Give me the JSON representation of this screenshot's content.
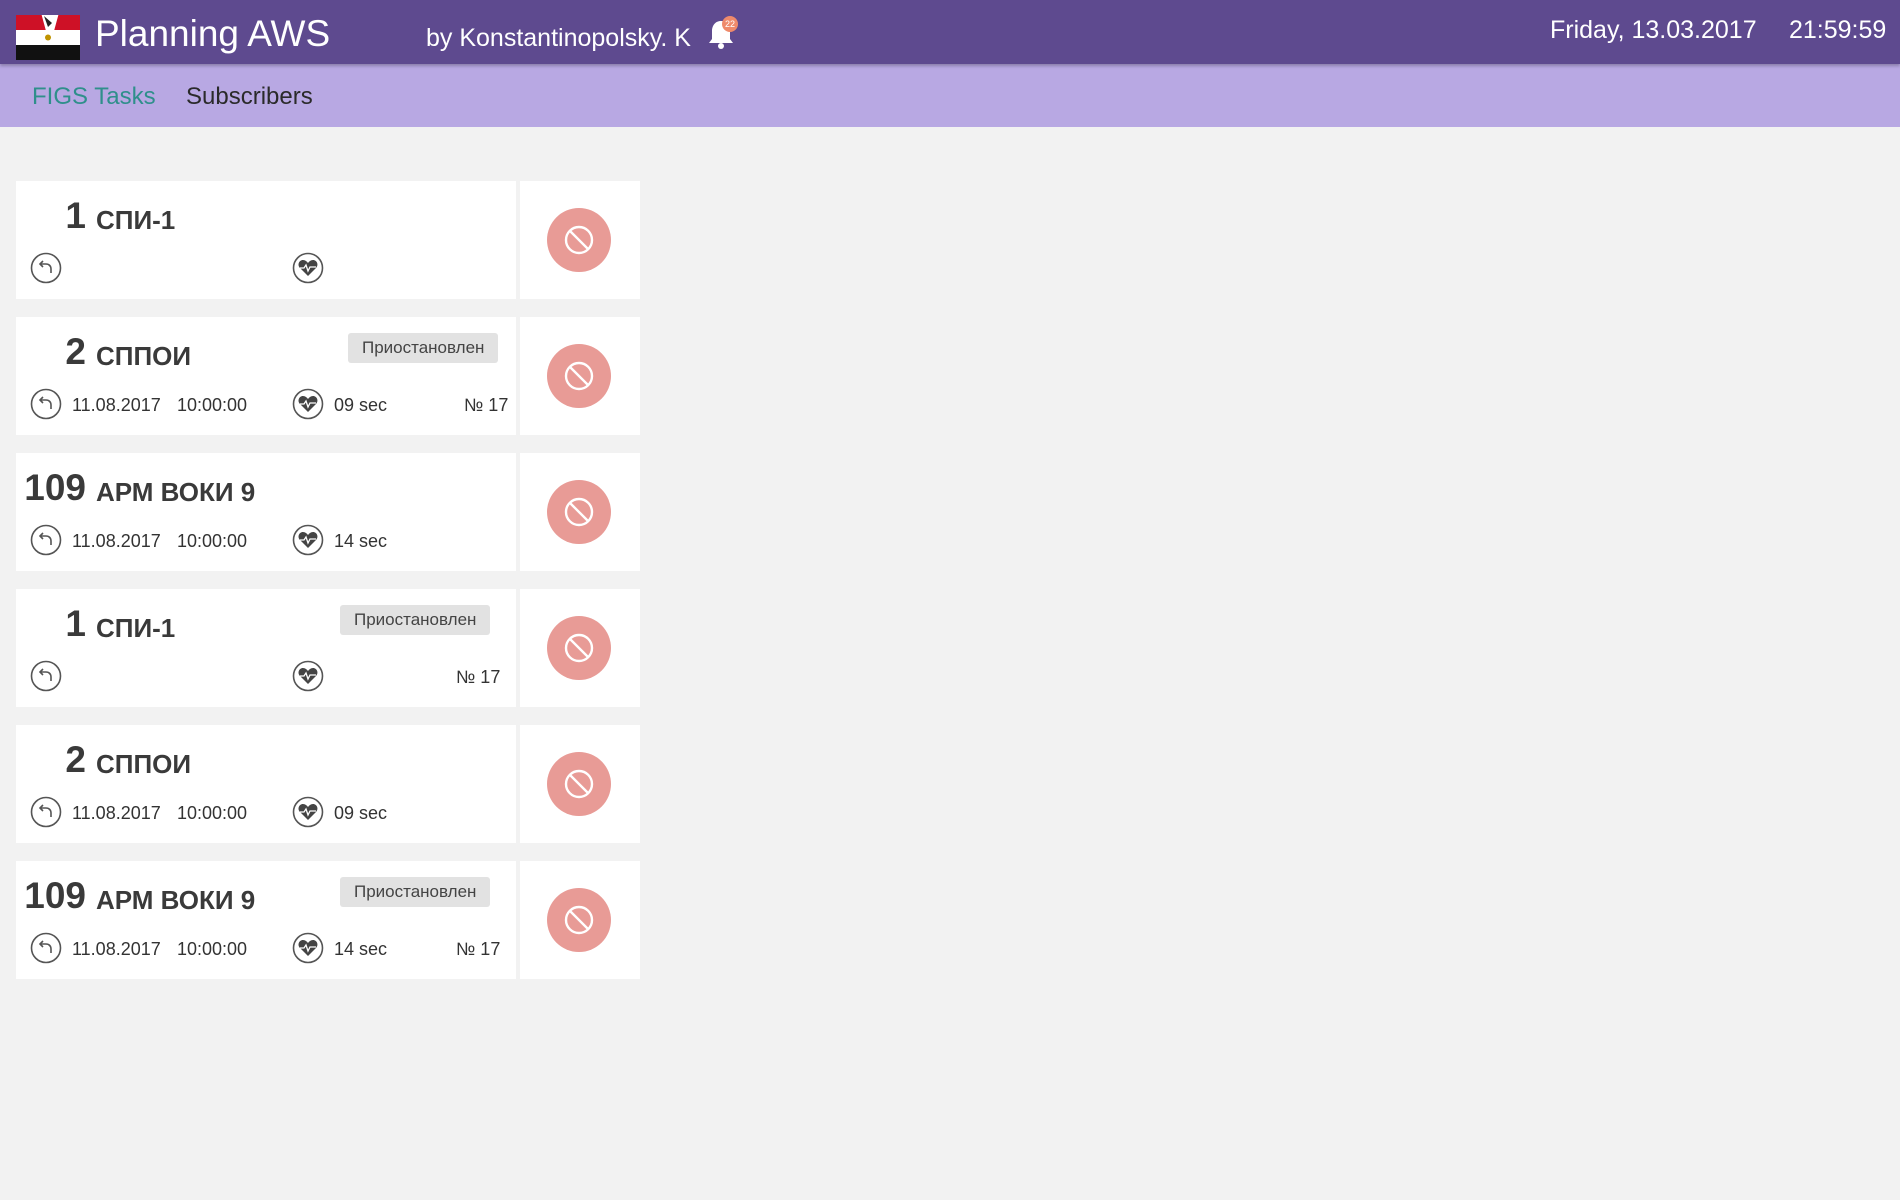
{
  "header": {
    "app_title": "Planning AWS",
    "author": "by Konstantinopolsky. K",
    "notification_count": "22",
    "date": "Friday, 13.03.2017",
    "time": "21:59:59"
  },
  "nav": {
    "tabs": [
      {
        "label": "FIGS Tasks",
        "active": true
      },
      {
        "label": "Subscribers",
        "active": false
      }
    ]
  },
  "colors": {
    "topbar": "#5e4a8f",
    "navbar": "#b8a8e3",
    "active_tab": "#2f8f8b",
    "block_button": "#e89b96",
    "notification_badge": "#ef8a6b"
  },
  "icons": {
    "repeat": "history-icon",
    "heartbeat": "heartbeat-icon",
    "block": "block-icon",
    "bell": "bell-icon",
    "flag": "egypt-flag-icon"
  },
  "tasks": [
    {
      "number": "1",
      "name": "СПИ-1",
      "status": "",
      "date": "",
      "time": "",
      "interval": "",
      "index": ""
    },
    {
      "number": "2",
      "name": "СППОИ",
      "status": "Приостановлен",
      "date": "11.08.2017",
      "time": "10:00:00",
      "interval": "09 sec",
      "index": "№ 17"
    },
    {
      "number": "109",
      "name": "АРМ ВОКИ 9",
      "status": "",
      "date": "11.08.2017",
      "time": "10:00:00",
      "interval": "14 sec",
      "index": ""
    },
    {
      "number": "1",
      "name": "СПИ-1",
      "status": "Приостановлен",
      "date": "",
      "time": "",
      "interval": "",
      "index": "№ 17"
    },
    {
      "number": "2",
      "name": "СППОИ",
      "status": "",
      "date": "11.08.2017",
      "time": "10:00:00",
      "interval": "09 sec",
      "index": ""
    },
    {
      "number": "109",
      "name": "АРМ ВОКИ 9",
      "status": "Приостановлен",
      "date": "11.08.2017",
      "time": "10:00:00",
      "interval": "14 sec",
      "index": "№ 17"
    }
  ]
}
